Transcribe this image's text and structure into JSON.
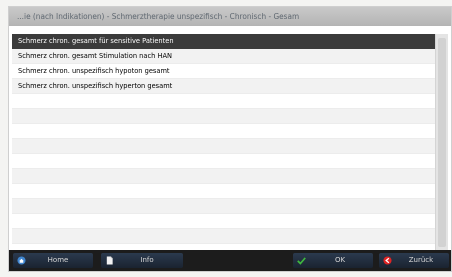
{
  "window": {
    "title": "...ie (nach Indikationen) - Schmerztherapie unspezifisch - Chronisch - Gesam"
  },
  "list": {
    "items": [
      {
        "label": "Schmerz chron. gesamt für sensitive Patienten",
        "selected": true
      },
      {
        "label": "Schmerz chron. gesamt Stimulation nach HAN",
        "selected": false
      },
      {
        "label": "Schmerz chron. unspezifisch hypoton gesamt",
        "selected": false
      },
      {
        "label": "Schmerz chron. unspezifisch hyperton gesamt",
        "selected": false
      },
      {
        "label": "",
        "selected": false
      },
      {
        "label": "",
        "selected": false
      },
      {
        "label": "",
        "selected": false
      },
      {
        "label": "",
        "selected": false
      },
      {
        "label": "",
        "selected": false
      },
      {
        "label": "",
        "selected": false
      },
      {
        "label": "",
        "selected": false
      },
      {
        "label": "",
        "selected": false
      },
      {
        "label": "",
        "selected": false
      },
      {
        "label": "",
        "selected": false
      },
      {
        "label": "",
        "selected": false
      }
    ]
  },
  "toolbar": {
    "home_label": "Home",
    "info_label": "Info",
    "ok_label": "OK",
    "back_label": "Zurück"
  },
  "icons": {
    "home": "home-icon",
    "info": "document-icon",
    "ok": "checkmark-icon",
    "back": "back-arrow-icon"
  },
  "colors": {
    "selected_row": "#3b3b3b",
    "toolbar_bg": "#1c1c1c",
    "ok_icon": "#3fb93f",
    "back_icon": "#e02424",
    "home_icon": "#3f86d0"
  }
}
